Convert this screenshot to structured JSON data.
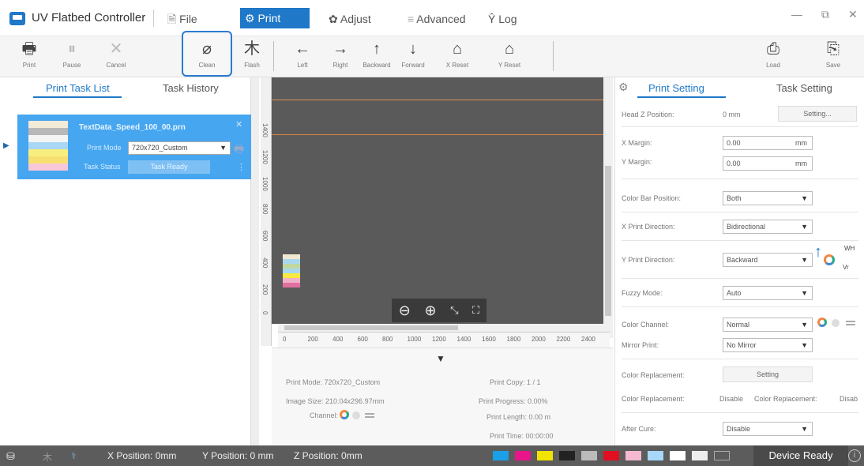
{
  "app": {
    "title": "UV Flatbed Controller"
  },
  "menu": {
    "file": "File",
    "print": "Print",
    "adjust": "Adjust",
    "advanced": "Advanced",
    "log": "Log",
    "file_icon": "document-icon",
    "print_icon": "gear-icon"
  },
  "toolbar": {
    "print": "Print",
    "pause": "Pause",
    "cancel": "Cancel",
    "clean": "Clean",
    "flash": "Flash",
    "left": "Left",
    "right": "Right",
    "backward": "Backward",
    "forward": "Forward",
    "x_reset": "X Reset",
    "y_reset": "Y Reset",
    "load": "Load",
    "save": "Save"
  },
  "left": {
    "tab_tasks": "Print Task List",
    "tab_history": "Task History",
    "task": {
      "name": "TextData_Speed_100_00.prn",
      "print_mode_label": "Print Mode",
      "print_mode": "720x720_Custom",
      "status_label": "Task Status",
      "status": "Task Ready"
    }
  },
  "canvas": {
    "rulers_x": [
      "0",
      "200",
      "400",
      "600",
      "800",
      "1000",
      "1200",
      "1400",
      "1600",
      "1800",
      "2000",
      "2200",
      "2400"
    ],
    "rulers_y": [
      "1400",
      "1200",
      "1000",
      "800",
      "600",
      "400",
      "200",
      "0"
    ]
  },
  "info": {
    "print_mode": "Print Mode: 720x720_Custom",
    "image_size": "Image Size: 210.04x296.97mm",
    "channel": "Channel:",
    "print_copy": "Print Copy: 1 / 1",
    "print_progress": "Print Progress: 0.00%",
    "print_length": "Print Length: 0.00 m",
    "print_time": "Print Time: 00:00:00"
  },
  "right": {
    "tab_print": "Print Setting",
    "tab_task": "Task Setting",
    "head_z_label": "Head Z Position:",
    "head_z": "0 mm",
    "setting_btn": "Setting...",
    "x_margin_label": "X Margin:",
    "x_margin": "0.00",
    "y_margin_label": "Y Margin:",
    "y_margin": "0.00",
    "unit": "mm",
    "color_bar_label": "Color Bar Position:",
    "color_bar": "Both",
    "x_dir_label": "X Print Direction:",
    "x_dir": "Bidirectional",
    "y_dir_label": "Y Print Direction:",
    "y_dir": "Backward",
    "wh": "WH",
    "vr": "Vr",
    "fuzzy_label": "Fuzzy Mode:",
    "fuzzy": "Auto",
    "color_channel_label": "Color Channel:",
    "color_channel": "Normal",
    "mirror_label": "Mirror Print:",
    "mirror": "No Mirror",
    "color_rep_label": "Color Replacement:",
    "color_rep_btn": "Setting",
    "color_rep2_label": "Color Replacement:",
    "color_rep2_val": "Disable",
    "color_rep3_label": "Color Replacement:",
    "color_rep3_val": "Disab",
    "after_cure_label": "After Cure:",
    "after_cure": "Disable"
  },
  "status": {
    "x_pos": "X Position: 0mm",
    "y_pos": "Y Position: 0 mm",
    "z_pos": "Z Position: 0mm",
    "device": "Device Ready",
    "ink_colors": [
      "#1aa0e8",
      "#e8168a",
      "#f0e400",
      "#222222",
      "#bbbbbb",
      "#e01020",
      "#f4b8d0",
      "#a8d8f8",
      "#ffffff",
      "#eeeeee",
      "#888888"
    ]
  },
  "colors": {
    "accent": "#1f78c8",
    "task_bg": "#47a6f0",
    "canvas": "#5a5a5a"
  }
}
